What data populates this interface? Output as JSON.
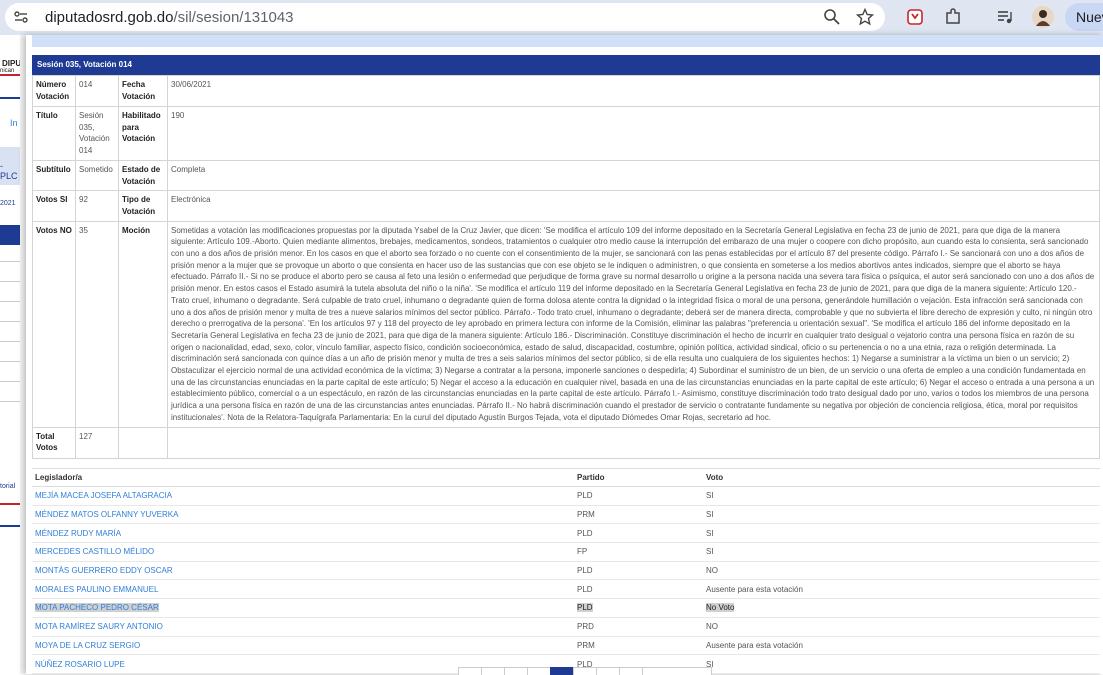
{
  "browser": {
    "url_domain": "diputadosrd.gob.do",
    "url_path": "/sil/sesion/131043",
    "new_tab_label": "Nuev"
  },
  "left_strip": {
    "t1": "DIPU",
    "t2": "nican",
    "t3": "In",
    "t4": "-PLC",
    "t5": "2021",
    "t6": "torial"
  },
  "header": {
    "title": "Sesión 035, Votación 014"
  },
  "info": {
    "numero_label": "Número Votación",
    "numero_value": "014",
    "fecha_label": "Fecha Votación",
    "fecha_value": "30/06/2021",
    "titulo_label": "Título",
    "titulo_value": "Sesión 035, Votación 014",
    "habilitado_label": "Habilitado para Votación",
    "habilitado_value": "190",
    "subtitulo_label": "Subtítulo",
    "subtitulo_value": "Sometido",
    "estado_label": "Estado de Votación",
    "estado_value": "Completa",
    "votos_si_label": "Votos SI",
    "votos_si_value": "92",
    "tipo_label": "Tipo de Votación",
    "tipo_value": "Electrónica",
    "votos_no_label": "Votos NO",
    "votos_no_value": "35",
    "mocion_label": "Moción",
    "mocion_value": "Sometidas a votación las modificaciones propuestas por la diputada Ysabel de la Cruz Javier, que dicen: 'Se modifica el artículo 109 del informe depositado en la Secretaría General Legislativa en fecha 23 de junio de 2021, para que diga de la manera siguiente: Artículo 109.-Aborto. Quien mediante alimentos, brebajes, medicamentos, sondeos, tratamientos o cualquier otro medio cause la interrupción del embarazo de una mujer o coopere con dicho propósito, aun cuando esta lo consienta, será sancionado con uno a dos años de prisión menor. En los casos en que el aborto sea forzado o no cuente con el consentimiento de la mujer, se sancionará con las penas establecidas por el artículo 87 del presente código. Párrafo I.- Se sancionará con uno a dos años de prisión menor a la mujer que se provoque un aborto o que consienta en hacer uso de las sustancias que con ese objeto se le indiquen o administren, o que consienta en someterse a los medios abortivos antes indicados, siempre que el aborto se haya efectuado. Párrafo II.- Si no se produce el aborto pero se causa al feto una lesión o enfermedad que perjudique de forma grave su normal desarrollo u origine a la persona nacida una severa tara física o psíquica, el autor será sancionado con uno a dos años de prisión menor. En estos casos el Estado asumirá la tutela absoluta del niño o la niña'. 'Se modifica el artículo 119 del informe depositado en la Secretaría General Legislativa en fecha 23 de junio de 2021, para que diga de la manera siguiente: Artículo 120.- Trato cruel, inhumano o degradante. Será culpable de trato cruel, inhumano o degradante quien de forma dolosa atente contra la dignidad o la integridad física o moral de una persona, generándole humillación o vejación. Esta infracción será sancionada con uno a dos años de prisión menor y multa de tres a nueve salarios mínimos del sector público. Párrafo.- Todo trato cruel, inhumano o degradante; deberá ser de manera directa, comprobable y que no subvierta el libre derecho de expresión y culto, ni ningún otro derecho o prerrogativa de la persona'. 'En los artículos 97 y 118 del proyecto de ley aprobado en primera lectura con informe de la Comisión, eliminar las palabras \"preferencia u orientación sexual\". 'Se modifica el artículo 186 del informe depositado en la Secretaría General Legislativa en fecha 23 de junio de 2021, para que diga de la manera siguiente: Artículo 186.- Discriminación. Constituye discriminación el hecho de incurrir en cualquier trato desigual o vejatorio contra una persona física en razón de su origen o nacionalidad, edad, sexo, color, vínculo familiar, aspecto físico, condición socioeconómica, estado de salud, discapacidad, costumbre, opinión política, actividad sindical, oficio o su pertenencia o no a una etnia, raza o religión determinada. La discriminación será sancionada con quince días a un año de prisión menor y multa de tres a seis salarios mínimos del sector público, si de ella resulta uno cualquiera de los siguientes hechos: 1) Negarse a suministrar a la víctima un bien o un servicio; 2) Obstaculizar el ejercicio normal de una actividad económica de la víctima; 3) Negarse a contratar a la persona, imponerle sanciones o despedirla; 4) Subordinar el suministro de un bien, de un servicio o una oferta de empleo a una condición fundamentada en una de las circunstancias enunciadas en la parte capital de este artículo; 5) Negar el acceso a la educación en cualquier nivel, basada en una de las circunstancias enunciadas en la parte capital de este artículo; 6) Negar el acceso o entrada a una persona a un establecimiento público, comercial o a un espectáculo, en razón de las circunstancias enunciadas en la parte capital de este artículo. Párrafo I.- Asimismo, constituye discriminación todo trato desigual dado por uno, varios o todos los miembros de una persona jurídica a una persona física en razón de una de las circunstancias antes enunciadas. Párrafo II.- No habrá discriminación cuando el prestador de servicio o contratante fundamente su negativa por objeción de conciencia religiosa, ética, moral por requisitos institucionales'. Nota de la Relatora-Taquígrafa Parlamentaria: En la curul del diputado Agustín Burgos Tejada, vota el diputado Diómedes Omar Rojas, secretario ad hoc.",
    "total_label": "Total Votos",
    "total_value": "127"
  },
  "legislators": {
    "headers": [
      "Legislador/a",
      "Partido",
      "Voto"
    ],
    "rows": [
      {
        "name": "MEJÍA MACEA JOSEFA ALTAGRACIA",
        "party": "PLD",
        "vote": "SI"
      },
      {
        "name": "MÉNDEZ MATOS OLFANNY YUVERKA",
        "party": "PRM",
        "vote": "SI"
      },
      {
        "name": "MÉNDEZ RUDY MARÍA",
        "party": "PLD",
        "vote": "SI"
      },
      {
        "name": "MERCEDES CASTILLO MÉLIDO",
        "party": "FP",
        "vote": "SI"
      },
      {
        "name": "MONTÁS GUERRERO EDDY OSCAR",
        "party": "PLD",
        "vote": "NO"
      },
      {
        "name": "MORALES PAULINO EMMANUEL",
        "party": "PLD",
        "vote": "Ausente para esta votación"
      },
      {
        "name": "MOTA PACHECO PEDRO CÉSAR",
        "party": "PLD",
        "vote": "No Voto"
      },
      {
        "name": "MOTA RAMÍREZ SAURY ANTONIO",
        "party": "PRD",
        "vote": "NO"
      },
      {
        "name": "MOYA DE LA CRUZ SERGIO",
        "party": "PRM",
        "vote": "Ausente para esta votación"
      },
      {
        "name": "NÚÑEZ ROSARIO LUPE",
        "party": "PLD",
        "vote": "SI"
      }
    ]
  }
}
